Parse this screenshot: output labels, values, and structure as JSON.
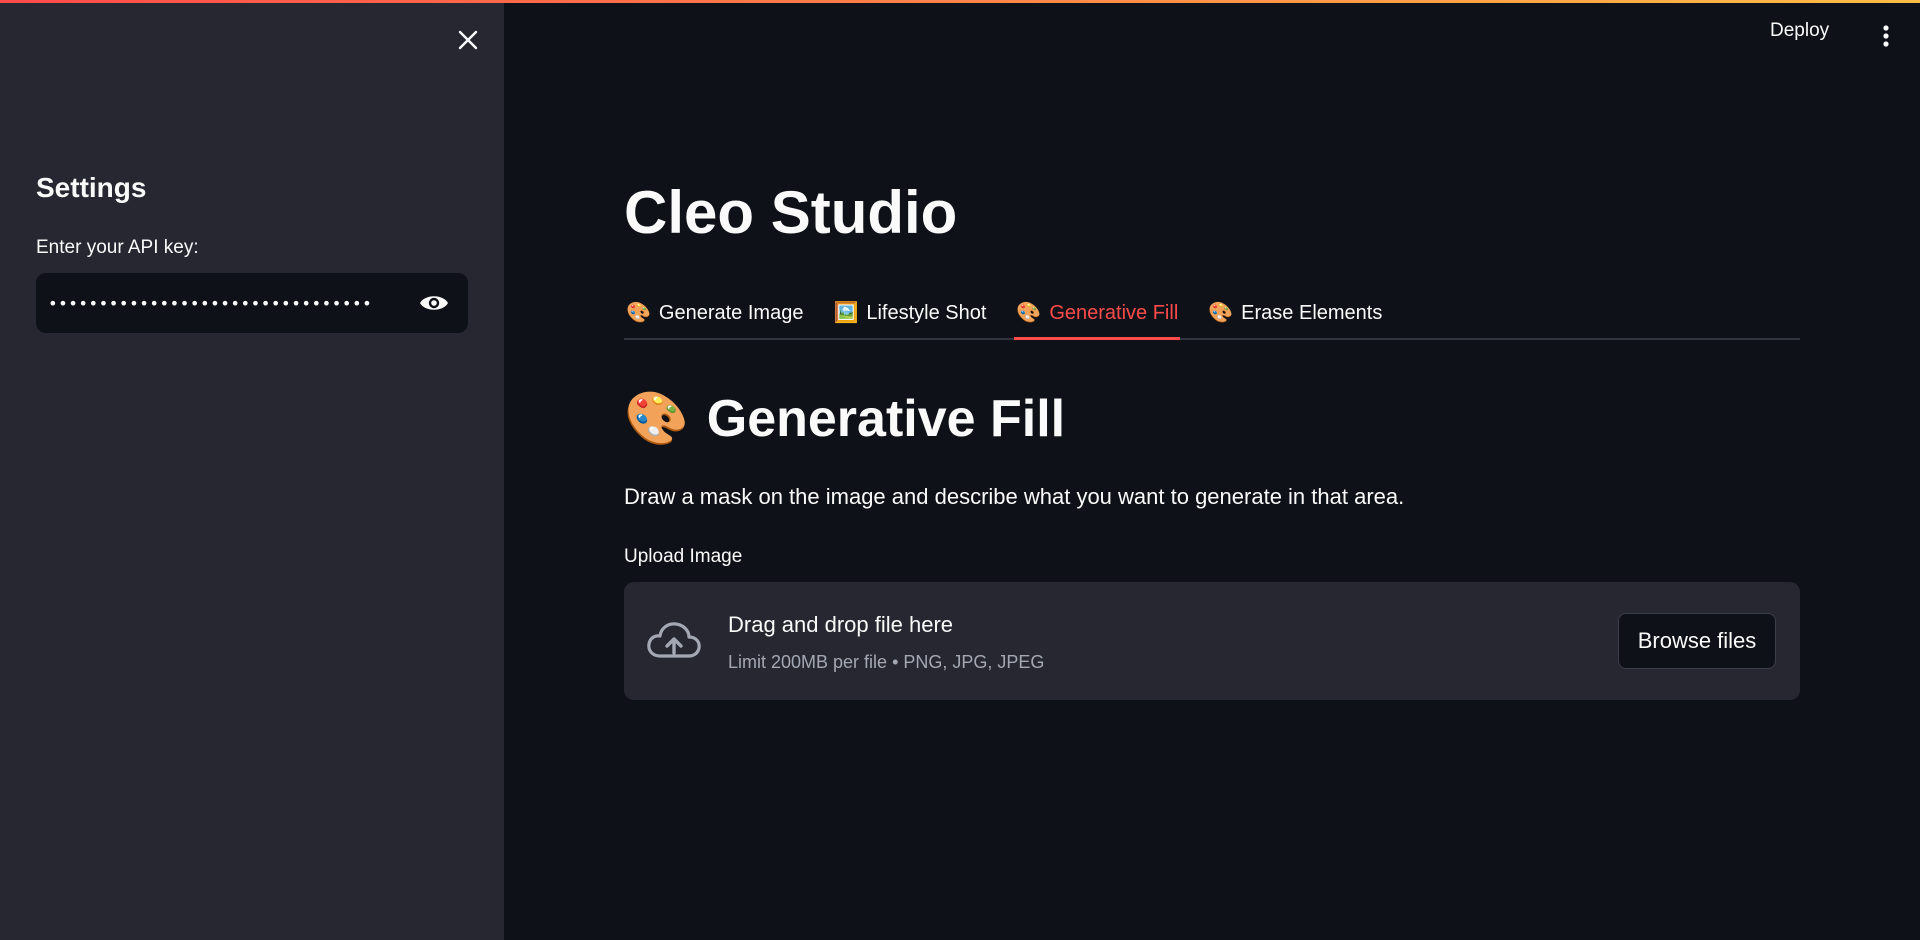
{
  "sidebar": {
    "title": "Settings",
    "api_label": "Enter your API key:",
    "api_value": "••••••••••••••••••••••••••••••••"
  },
  "header": {
    "deploy_label": "Deploy"
  },
  "main": {
    "app_title": "Cleo Studio",
    "tabs": [
      {
        "icon": "🎨",
        "label": "Generate Image"
      },
      {
        "icon": "🖼️",
        "label": "Lifestyle Shot"
      },
      {
        "icon": "🎨",
        "label": "Generative Fill"
      },
      {
        "icon": "🎨",
        "label": "Erase Elements"
      }
    ],
    "active_tab": "Generative Fill",
    "section_icon": "🎨",
    "section_title": "Generative Fill",
    "section_description": "Draw a mask on the image and describe what you want to generate in that area.",
    "upload": {
      "label": "Upload Image",
      "drop_title": "Drag and drop file here",
      "drop_limit": "Limit 200MB per file • PNG, JPG, JPEG",
      "browse_label": "Browse files"
    }
  },
  "colors": {
    "background": "#0e1117",
    "sidebar": "#262730",
    "accent": "#ff4b4b",
    "muted_text": "#a3a8b4"
  }
}
